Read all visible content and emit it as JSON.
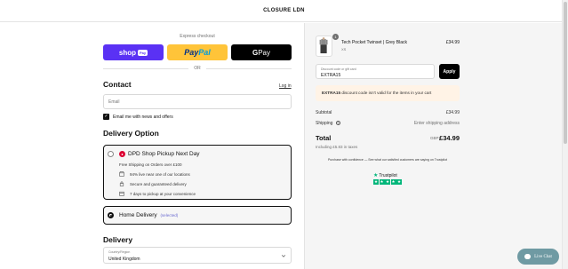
{
  "brand": {
    "logo": "CLOSURE LDN"
  },
  "express": {
    "label": "Express checkout",
    "shop_pay": {
      "text": "shop",
      "pill": "Pay"
    },
    "paypal": {
      "part1": "Pay",
      "part2": "Pal"
    },
    "gpay": {
      "g": "G",
      "text": " Pay"
    },
    "or_text": "OR"
  },
  "contact": {
    "title": "Contact",
    "login": "Log in",
    "email_placeholder": "Email",
    "newsletter": "Email me with news and offers",
    "newsletter_checked": true
  },
  "delivery_option": {
    "title": "Delivery Option",
    "dpd": {
      "title": "DPD Shop Pickup Next Day",
      "free_shipping": "Free Shipping on Orders over £100",
      "features": [
        "94% live near one of our locations",
        "Secure and guaranteed delivery",
        "7 days to pickup at your convenience"
      ]
    },
    "home": {
      "title": "Home Delivery",
      "tag": "(selected)"
    }
  },
  "delivery": {
    "title": "Delivery",
    "country_label": "Country/Region",
    "country_value": "United Kingdom"
  },
  "cart": {
    "qty": "1",
    "item_name": "Tech Pocket Twinset | Grey Black",
    "item_variant": "XS",
    "item_price": "£34.99"
  },
  "discount": {
    "label": "Discount code or gift card",
    "value": "EXTRA15",
    "apply": "Apply",
    "warning_code": "EXTRA15",
    "warning_text": " discount code isn't valid for the items in your cart"
  },
  "summary": {
    "subtotal_label": "Subtotal",
    "subtotal_value": "£34.99",
    "shipping_label": "Shipping",
    "shipping_value": "Enter shipping address",
    "total_label": "Total",
    "currency": "GBP",
    "total_value": "£34.99",
    "taxes": "Including £5.83 in taxes"
  },
  "trust": {
    "confidence": "Purchase with confidence — See what our satisfied customers are saying on Trustpilot",
    "trustpilot": "Trustpilot",
    "stars": 5
  },
  "chat": {
    "label": "Live Chat"
  },
  "colors": {
    "shop_pay": "#5a31f4",
    "paypal": "#ffc439",
    "trustpilot": "#00b67a",
    "dpd": "#dc0032",
    "chat": "#6f9aa3"
  }
}
